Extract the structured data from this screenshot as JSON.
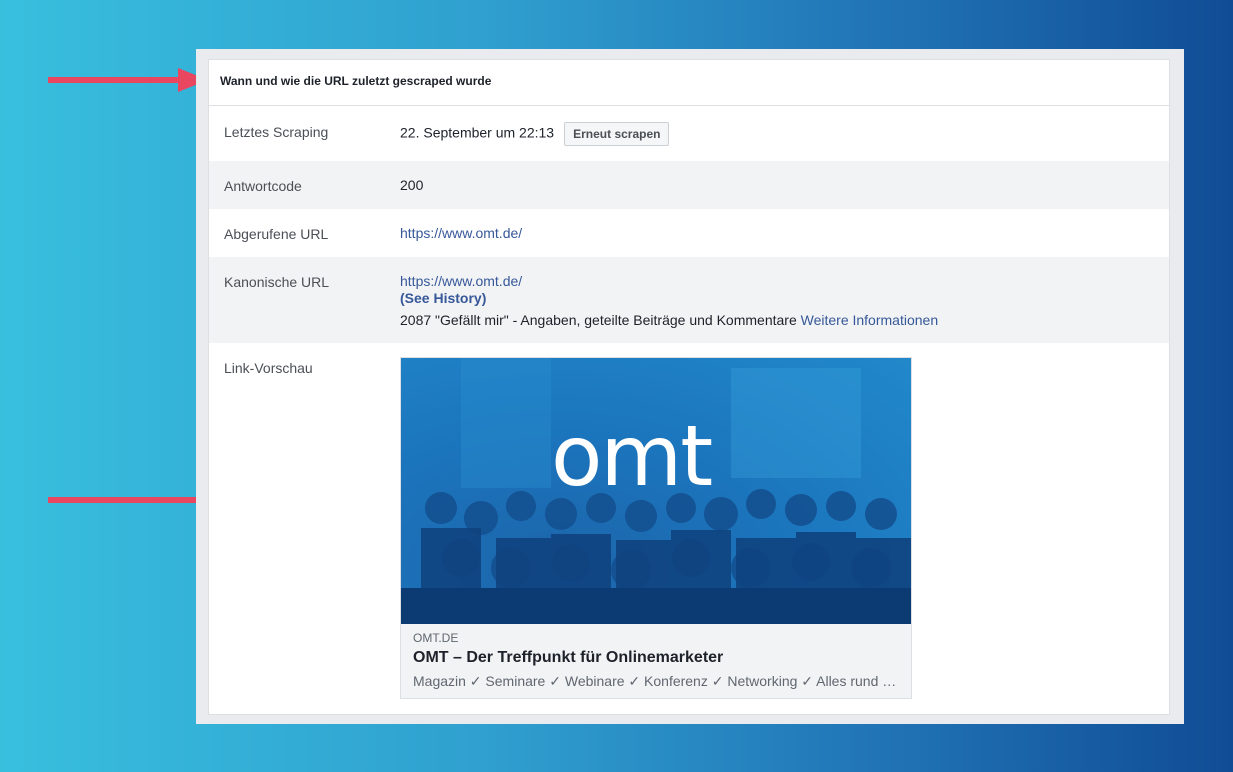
{
  "colors": {
    "arrow": "#e8475f",
    "link": "#365899",
    "panel_bg": "#ffffff",
    "row_alt_bg": "#f2f3f5",
    "background_gradient": [
      "#38bfde",
      "#104c95"
    ]
  },
  "panel": {
    "title": "Wann und wie die URL zuletzt gescraped wurde",
    "rows": [
      {
        "label": "Letztes Scraping",
        "value": "22. September um 22:13",
        "button": "Erneut scrapen"
      },
      {
        "label": "Antwortcode",
        "value": "200"
      },
      {
        "label": "Abgerufene URL",
        "value": "https://www.omt.de/"
      },
      {
        "label": "Kanonische URL",
        "value": "https://www.omt.de/",
        "history": "(See History)",
        "likes": "2087 \"Gefällt mir\" - Angaben, geteilte Beiträge und Kommentare",
        "more": "Weitere Informationen"
      },
      {
        "label": "Link-Vorschau"
      }
    ]
  },
  "preview": {
    "logo": "omt",
    "domain": "OMT.DE",
    "title": "OMT – Der Treffpunkt für Onlinemarketer",
    "description": "Magazin ✓ Seminare ✓ Webinare ✓ Konferenz ✓ Networking ✓ Alles rund um Onlinemarketing"
  },
  "icons": [
    "arrow-right-icon",
    "arrow-right-icon"
  ]
}
